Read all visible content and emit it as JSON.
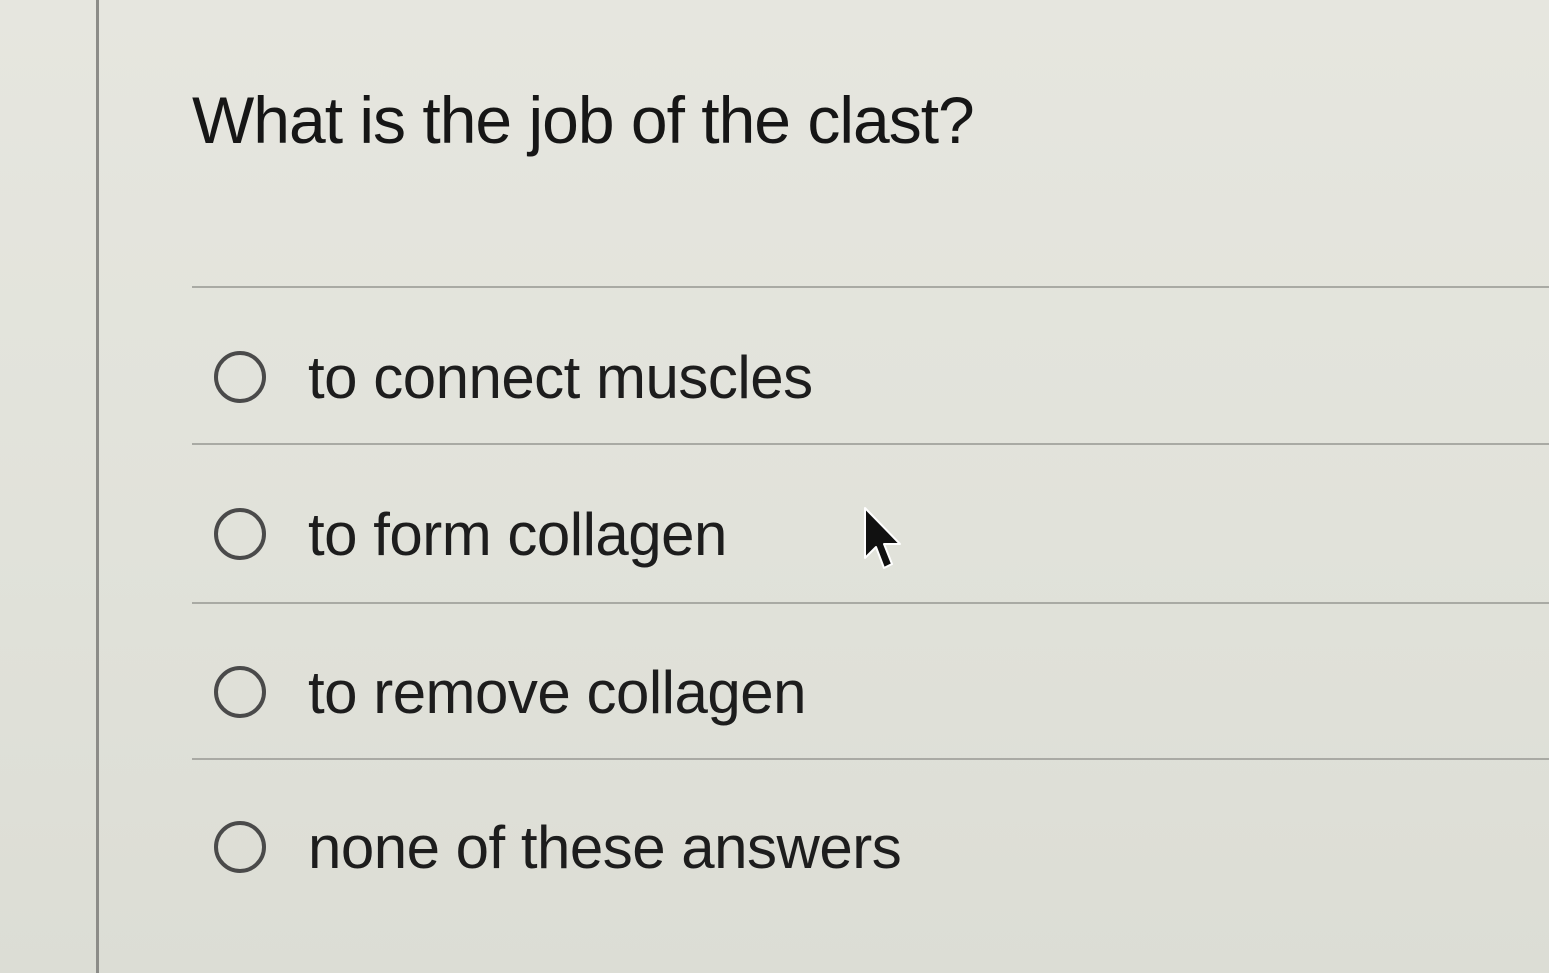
{
  "question": {
    "title": "What is the job of the clast?"
  },
  "choices": [
    {
      "label": "to connect muscles"
    },
    {
      "label": "to form collagen"
    },
    {
      "label": "to remove collagen"
    },
    {
      "label": "none of these answers"
    }
  ],
  "colors": {
    "background": "#e3e3dc",
    "text": "#161616",
    "divider": "#a9aaa4",
    "radio_border": "#4a4a4a"
  },
  "icons": {
    "cursor": "mouse-pointer-icon"
  }
}
